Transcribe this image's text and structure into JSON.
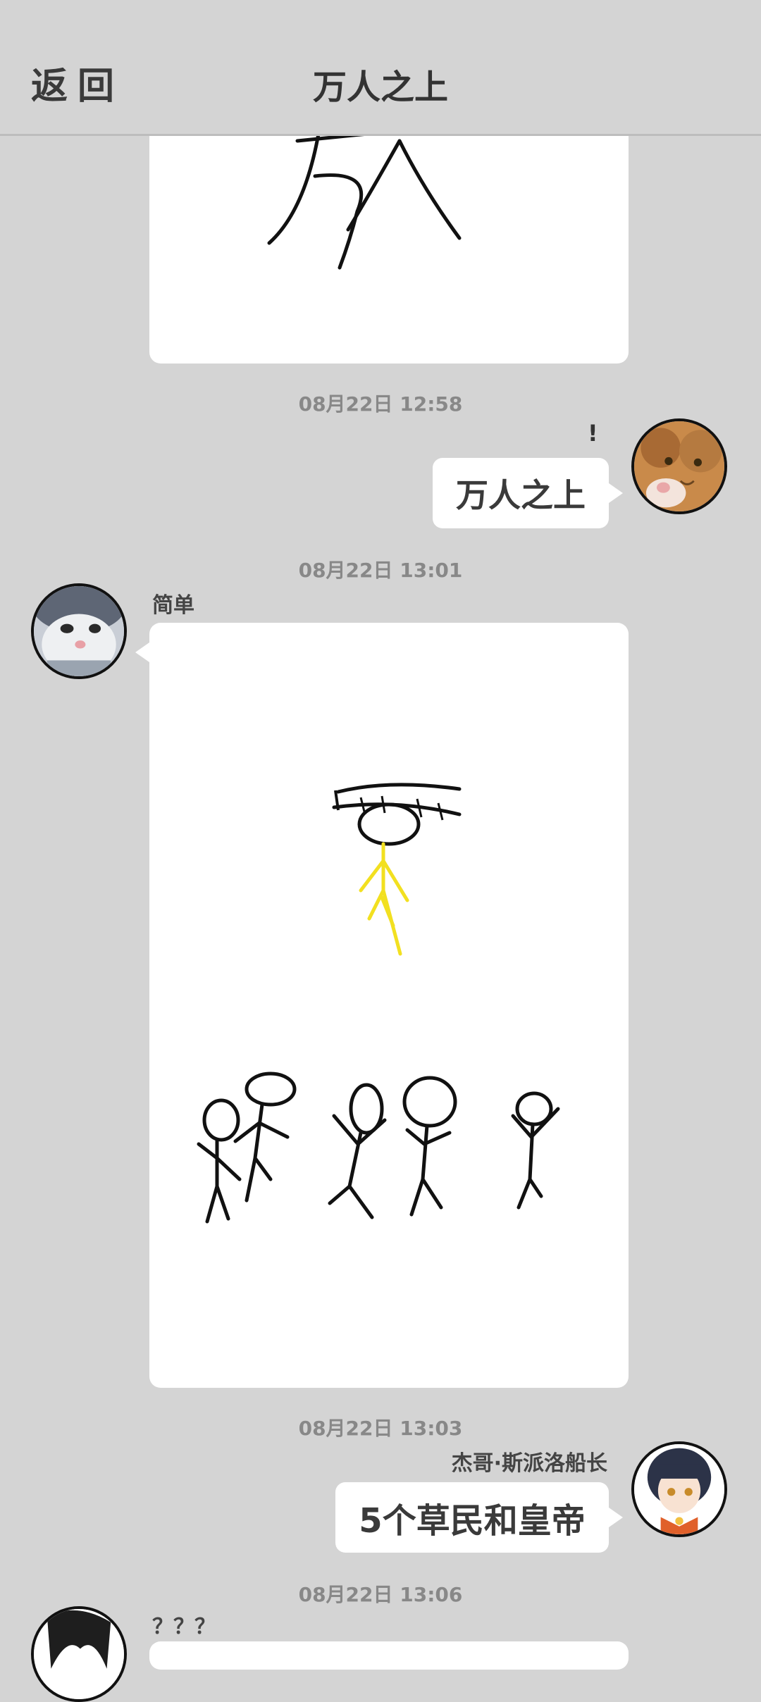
{
  "header": {
    "back_label": "返回",
    "title": "万人之上"
  },
  "messages": [
    {
      "type": "image",
      "side": "left",
      "image_text": "万人"
    },
    {
      "timestamp": "08月22日  12:58",
      "type": "text",
      "side": "right",
      "text": "万人之上",
      "status_mark": "!"
    },
    {
      "timestamp": "08月22日  13:01",
      "type": "image",
      "side": "left",
      "sender": "简单"
    },
    {
      "timestamp": "08月22日  13:03",
      "type": "text",
      "side": "right",
      "sender": "杰哥·斯派洛船长",
      "text": "5个草民和皇帝"
    },
    {
      "timestamp": "08月22日  13:06",
      "type": "text",
      "side": "left",
      "sender": "？？？"
    }
  ],
  "colors": {
    "background": "#d4d4d4",
    "bubble": "#ffffff",
    "emperor_body": "#f2e020"
  }
}
